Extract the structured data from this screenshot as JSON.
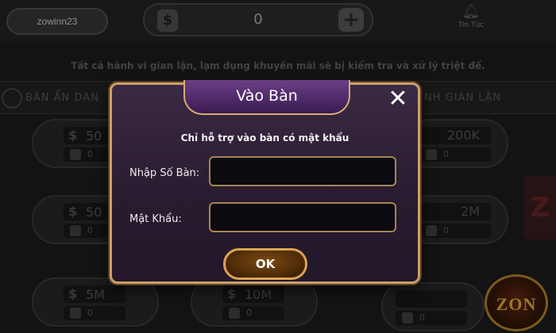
{
  "topbar": {
    "username": "zowinn23",
    "balance": "0",
    "currency_symbol": "$",
    "plus_symbol": "+",
    "news_label": "Tin Tức",
    "news_icon": "bell-icon"
  },
  "notice": "Tất cả hành vi gian lận, lạm dụng khuyến mãi sẽ bị kiểm tra và xử lý triệt để.",
  "lobby": {
    "tab_left": "BÀN ẨN DAN",
    "tab_right": "NH GIAN LẬN",
    "left_rooms": [
      {
        "bet": "50",
        "players": "0"
      },
      {
        "bet": "50",
        "players": "0"
      },
      {
        "bet": "5M",
        "players": "0"
      }
    ],
    "mid_room": {
      "bet": "10M",
      "players": "0"
    },
    "right_rooms": [
      {
        "bet": "200K",
        "players": "0"
      },
      {
        "bet": "2M",
        "players": "0"
      },
      {
        "bet": "",
        "players": "0"
      }
    ],
    "side_emblem": "Z",
    "logo": "ZON"
  },
  "dialog": {
    "title": "Vào Bàn",
    "close_symbol": "✕",
    "hint": "Chỉ hỗ trợ vào bàn có mật khẩu",
    "table_number_label": "Nhập Số Bàn:",
    "table_number_value": "",
    "password_label": "Mật Khẩu:",
    "password_value": "",
    "ok_label": "OK"
  },
  "colors": {
    "dialog_border": "#c9a06a",
    "dialog_bg": "#2a1c30",
    "header_bg": "#6a3f86",
    "ok_border": "#d9a554"
  }
}
